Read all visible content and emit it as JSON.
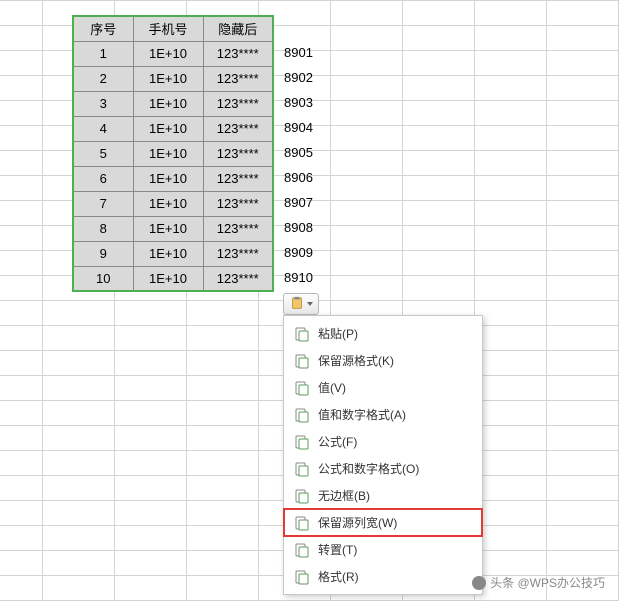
{
  "table": {
    "headers": [
      "序号",
      "手机号",
      "隐藏后"
    ],
    "rows": [
      {
        "seq": "1",
        "phone": "1E+10",
        "hidden": "123****",
        "overflow": "8901"
      },
      {
        "seq": "2",
        "phone": "1E+10",
        "hidden": "123****",
        "overflow": "8902"
      },
      {
        "seq": "3",
        "phone": "1E+10",
        "hidden": "123****",
        "overflow": "8903"
      },
      {
        "seq": "4",
        "phone": "1E+10",
        "hidden": "123****",
        "overflow": "8904"
      },
      {
        "seq": "5",
        "phone": "1E+10",
        "hidden": "123****",
        "overflow": "8905"
      },
      {
        "seq": "6",
        "phone": "1E+10",
        "hidden": "123****",
        "overflow": "8906"
      },
      {
        "seq": "7",
        "phone": "1E+10",
        "hidden": "123****",
        "overflow": "8907"
      },
      {
        "seq": "8",
        "phone": "1E+10",
        "hidden": "123****",
        "overflow": "8908"
      },
      {
        "seq": "9",
        "phone": "1E+10",
        "hidden": "123****",
        "overflow": "8909"
      },
      {
        "seq": "10",
        "phone": "1E+10",
        "hidden": "123****",
        "overflow": "8910"
      }
    ]
  },
  "menu": {
    "items": [
      {
        "label": "粘贴(P)",
        "icon": "clipboard-icon",
        "highlighted": false
      },
      {
        "label": "保留源格式(K)",
        "icon": "clipboard-format-icon",
        "highlighted": false
      },
      {
        "label": "值(V)",
        "icon": "clipboard-value-icon",
        "highlighted": false
      },
      {
        "label": "值和数字格式(A)",
        "icon": "clipboard-value-num-icon",
        "highlighted": false
      },
      {
        "label": "公式(F)",
        "icon": "clipboard-formula-icon",
        "highlighted": false
      },
      {
        "label": "公式和数字格式(O)",
        "icon": "clipboard-formula-num-icon",
        "highlighted": false
      },
      {
        "label": "无边框(B)",
        "icon": "clipboard-noborder-icon",
        "highlighted": false
      },
      {
        "label": "保留源列宽(W)",
        "icon": "clipboard-colwidth-icon",
        "highlighted": true
      },
      {
        "label": "转置(T)",
        "icon": "clipboard-transpose-icon",
        "highlighted": false
      },
      {
        "label": "格式(R)",
        "icon": "clipboard-style-icon",
        "highlighted": false
      }
    ]
  },
  "watermark": "头条 @WPS办公技巧"
}
